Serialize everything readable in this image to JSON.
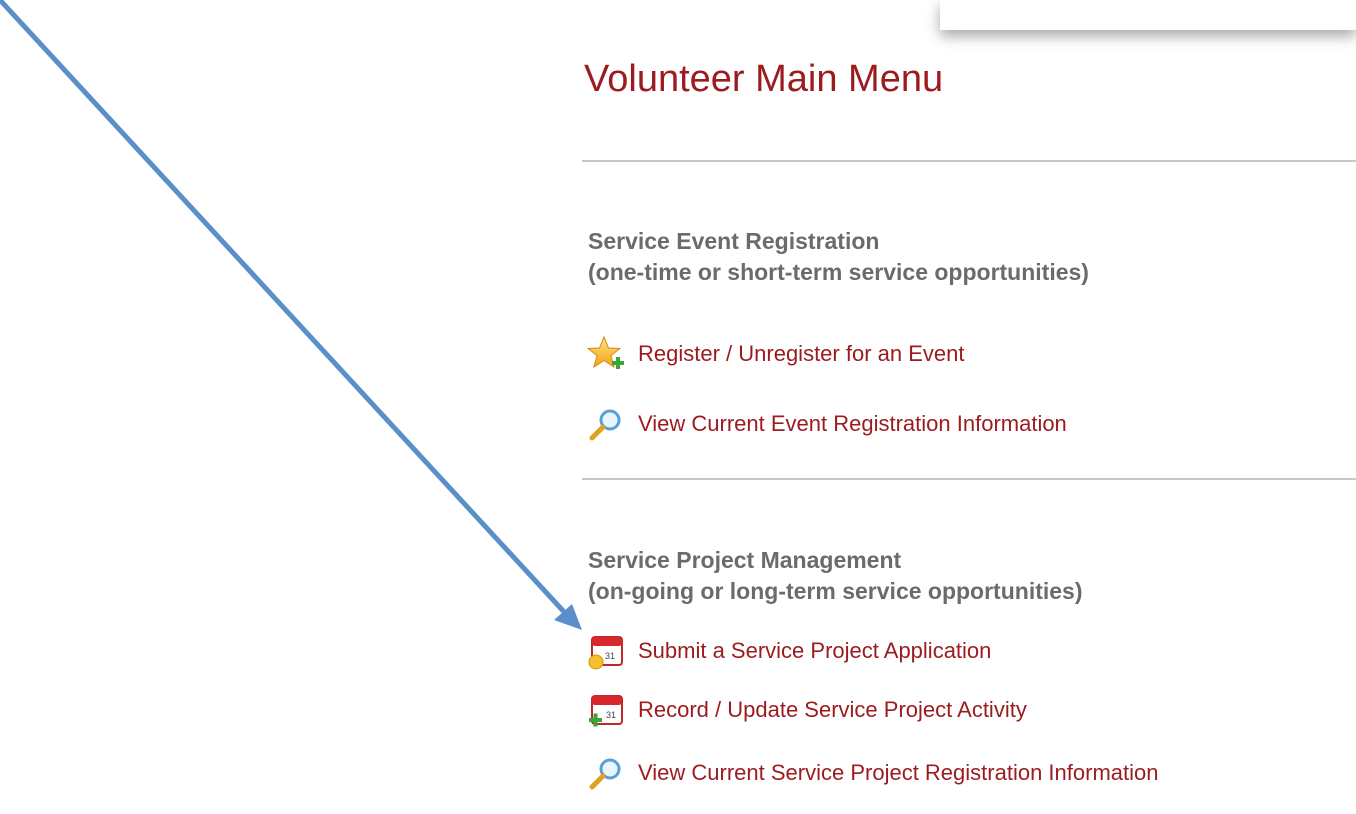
{
  "title": "Volunteer Main Menu",
  "colors": {
    "title": "#9b1b1f",
    "link": "#9b1b1f",
    "heading": "#6b6b6b",
    "arrow": "#5b8fc9",
    "divider": "#c8c8c8"
  },
  "sections": [
    {
      "heading_line1": "Service Event Registration",
      "heading_line2": "(one-time or short-term service opportunities)",
      "links": [
        {
          "label": "Register / Unregister for an Event",
          "icon": "star-add-icon"
        },
        {
          "label": "View Current Event Registration Information",
          "icon": "magnifier-icon"
        }
      ]
    },
    {
      "heading_line1": "Service Project Management",
      "heading_line2": "(on-going or long-term service opportunities)",
      "links": [
        {
          "label": "Submit a Service Project Application",
          "icon": "calendar-new-icon"
        },
        {
          "label": "Record / Update Service Project Activity",
          "icon": "calendar-add-icon"
        },
        {
          "label": "View Current Service Project Registration Information",
          "icon": "magnifier-icon"
        }
      ]
    }
  ]
}
